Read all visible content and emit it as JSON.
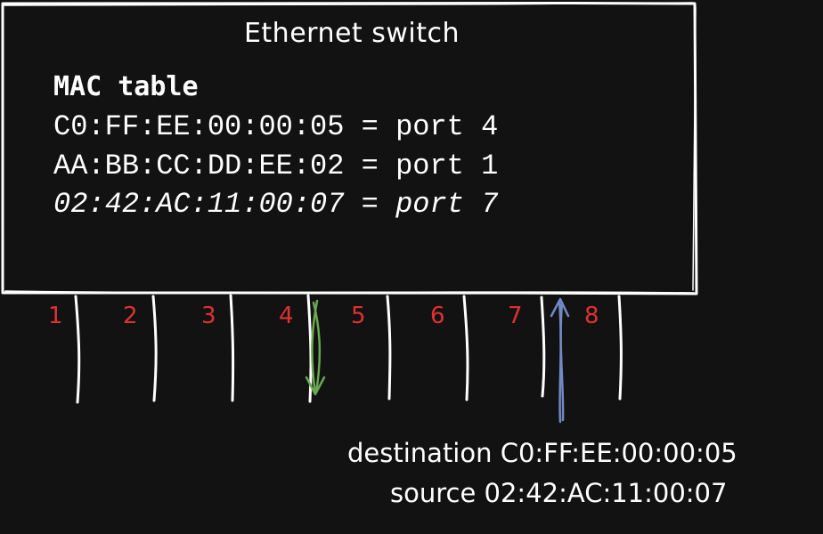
{
  "switch": {
    "title": "Ethernet switch"
  },
  "mac_table": {
    "header": "MAC table",
    "rows": [
      "C0:FF:EE:00:00:05 = port 4",
      "AA:BB:CC:DD:EE:02 = port 1",
      "02:42:AC:11:00:07 = port 7"
    ]
  },
  "ports": [
    "1",
    "2",
    "3",
    "4",
    "5",
    "6",
    "7",
    "8"
  ],
  "frame": {
    "destination_line": "destination C0:FF:EE:00:00:05",
    "source_line": "source 02:42:AC:11:00:07"
  },
  "colors": {
    "background": "#121212",
    "stroke": "#ffffff",
    "port_label": "#e03131",
    "outgoing_arrow": "#69a84f",
    "incoming_arrow": "#7389c4"
  },
  "icons": {
    "outgoing": "arrow-down-icon",
    "incoming": "arrow-up-icon"
  }
}
